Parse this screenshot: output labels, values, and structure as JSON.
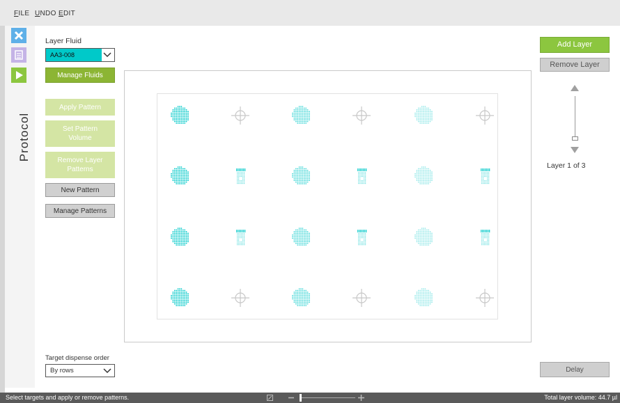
{
  "menu": {
    "file": "FILE",
    "file_key": "F",
    "file_rest": "ILE",
    "undo_key": "U",
    "undo_rest": "NDO",
    "edit_key": "E",
    "edit_rest": "DIT"
  },
  "sidebar": {
    "protocol_label": "Protocol",
    "icons": [
      "close-icon",
      "save-icon",
      "play-icon"
    ]
  },
  "layer_fluid": {
    "label": "Layer Fluid",
    "value": "AA3-008",
    "color": "#00c9c9"
  },
  "buttons": {
    "manage_fluids": "Manage Fluids",
    "apply_pattern": "Apply Pattern",
    "set_pattern_volume": "Set Pattern Volume",
    "remove_layer_patterns": "Remove Layer Patterns",
    "new_pattern": "New Pattern",
    "manage_patterns": "Manage Patterns",
    "add_layer": "Add Layer",
    "remove_layer": "Remove Layer",
    "delay": "Delay"
  },
  "layer": {
    "status": "Layer 1 of 3"
  },
  "dispense": {
    "label": "Target dispense order",
    "value": "By rows"
  },
  "status": {
    "message": "Select targets and apply or remove patterns.",
    "total_volume": "Total layer volume: 44.7 µl"
  },
  "colors": {
    "accent": "#8cc63f",
    "fluid": "#00c9c9"
  },
  "grid": {
    "rows": [
      [
        "dot-dark",
        "crosshair",
        "dot-mid",
        "crosshair",
        "dot-light",
        "crosshair"
      ],
      [
        "dot-dark",
        "pattern-mid",
        "dot-mid",
        "pattern-mid",
        "dot-light",
        "pattern-mid"
      ],
      [
        "dot-dark",
        "pattern-mid",
        "dot-mid",
        "pattern-mid",
        "dot-light",
        "pattern-mid"
      ],
      [
        "dot-dark",
        "crosshair",
        "dot-mid",
        "crosshair",
        "dot-light",
        "crosshair"
      ]
    ]
  }
}
